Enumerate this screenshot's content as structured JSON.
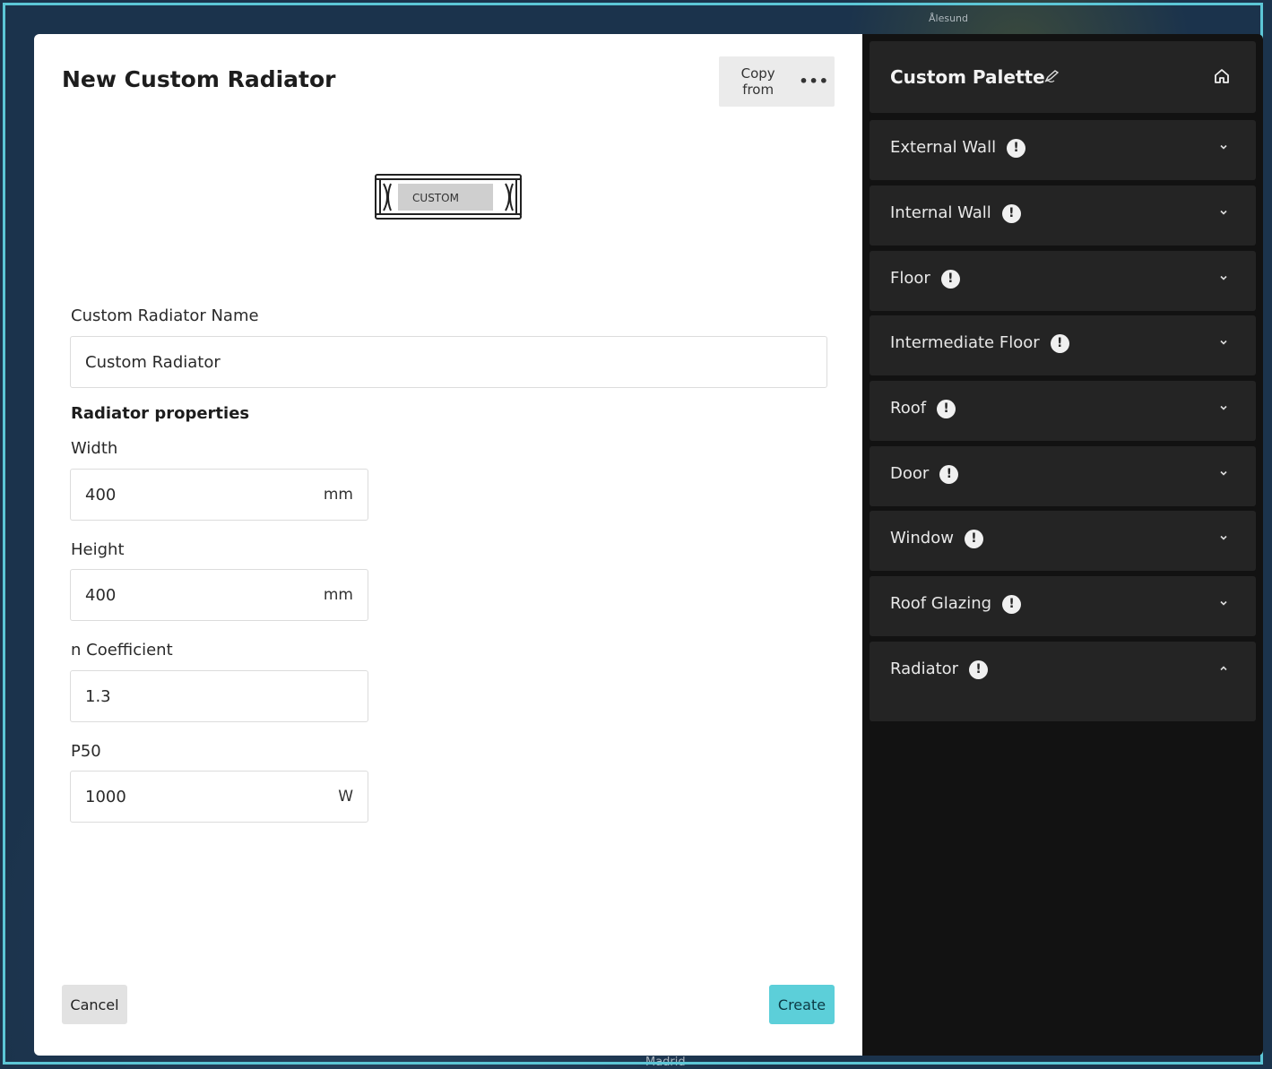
{
  "map": {
    "labels": [
      "Ålesund",
      "Madrid"
    ]
  },
  "modal": {
    "title": "New Custom Radiator",
    "copy_from_label": "Copy from",
    "copy_from_dots": "•••",
    "image_text": "CUSTOM",
    "name_label": "Custom Radiator Name",
    "name_value": "Custom Radiator",
    "section_title": "Radiator properties",
    "fields": [
      {
        "label": "Width",
        "value": "400",
        "unit": "mm"
      },
      {
        "label": "Height",
        "value": "400",
        "unit": "mm"
      },
      {
        "label": "n Coefficient",
        "value": "1.3",
        "unit": ""
      },
      {
        "label": "P50",
        "value": "1000",
        "unit": "W"
      }
    ],
    "cancel_label": "Cancel",
    "create_label": "Create"
  },
  "palette": {
    "title": "Custom Palette",
    "pencil_icon": "edit-pencil-icon",
    "home_icon": "home-icon",
    "items": [
      {
        "label": "External Wall",
        "warning": "!",
        "expanded": false
      },
      {
        "label": "Internal Wall",
        "warning": "!",
        "expanded": false
      },
      {
        "label": "Floor",
        "warning": "!",
        "expanded": false
      },
      {
        "label": "Intermediate Floor",
        "warning": "!",
        "expanded": false
      },
      {
        "label": "Roof",
        "warning": "!",
        "expanded": false
      },
      {
        "label": "Door",
        "warning": "!",
        "expanded": false
      },
      {
        "label": "Window",
        "warning": "!",
        "expanded": false
      },
      {
        "label": "Roof Glazing",
        "warning": "!",
        "expanded": false
      },
      {
        "label": "Radiator",
        "warning": "!",
        "expanded": true
      }
    ]
  },
  "colors": {
    "accent": "#5ccfd9",
    "panel": "#242424",
    "palette_bg": "#121212"
  }
}
